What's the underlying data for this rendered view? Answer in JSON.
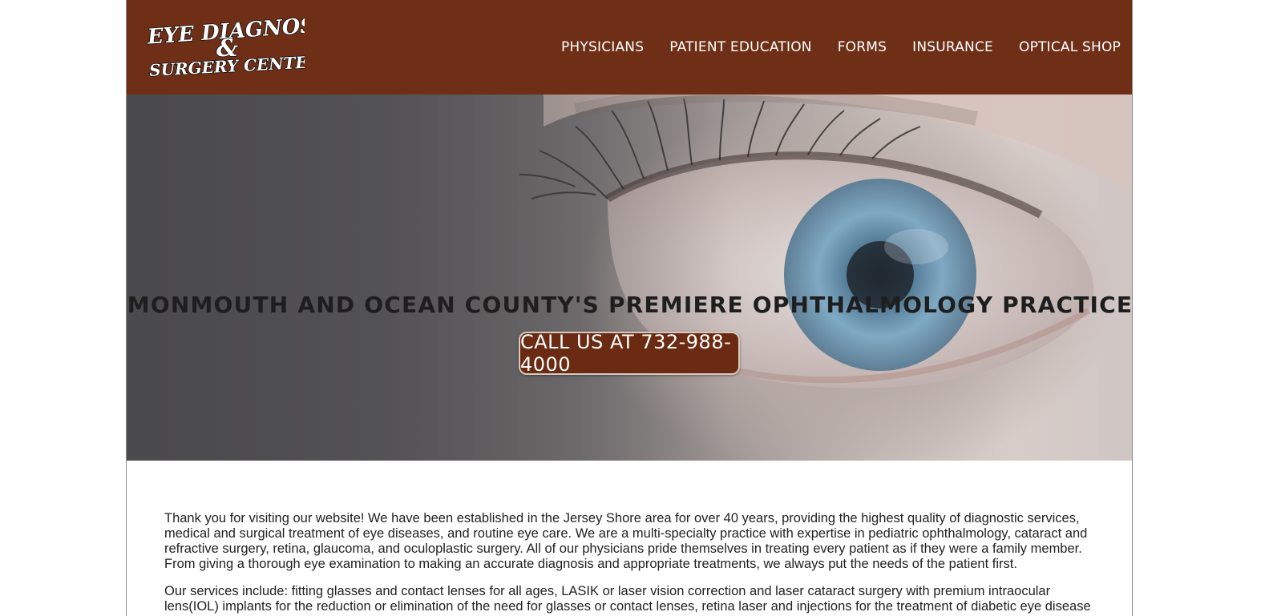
{
  "logo": {
    "line1": "EYE DIAGNOSTIC",
    "line2": "&",
    "line3": "SURGERY CENTER"
  },
  "nav": {
    "items": [
      {
        "label": "PHYSICIANS"
      },
      {
        "label": "PATIENT EDUCATION"
      },
      {
        "label": "FORMS"
      },
      {
        "label": "INSURANCE"
      },
      {
        "label": "OPTICAL SHOP"
      }
    ]
  },
  "hero": {
    "title": "MONMOUTH AND OCEAN COUNTY'S PREMIERE OPHTHALMOLOGY PRACTICE",
    "cta_label": "CALL US AT 732-988-4000"
  },
  "content": {
    "paragraph1": "Thank you for visiting our website! We have been established in the Jersey Shore area for over 40 years, providing the highest quality of diagnostic services, medical and surgical treatment of eye diseases, and routine eye care. We are a multi-specialty practice with expertise in pediatric ophthalmology, cataract and refractive surgery, retina, glaucoma, and oculoplastic surgery. All of our physicians pride themselves in treating every patient as if they were a family member. From giving a thorough eye examination to making an accurate diagnosis and appropriate treatments, we always put the needs of the patient first.",
    "paragraph2": "Our services include: fitting glasses and contact lenses for all ages, LASIK or laser vision correction and laser cataract surgery with premium intraocular lens(IOL) implants for the reduction or elimination of the need for glasses or contact lenses, retina laser and injections for the treatment of diabetic eye disease and macular"
  },
  "colors": {
    "header_bg": "#6e2f16",
    "cta_bg": "#6b2a12",
    "nav_text": "#ffffff"
  }
}
